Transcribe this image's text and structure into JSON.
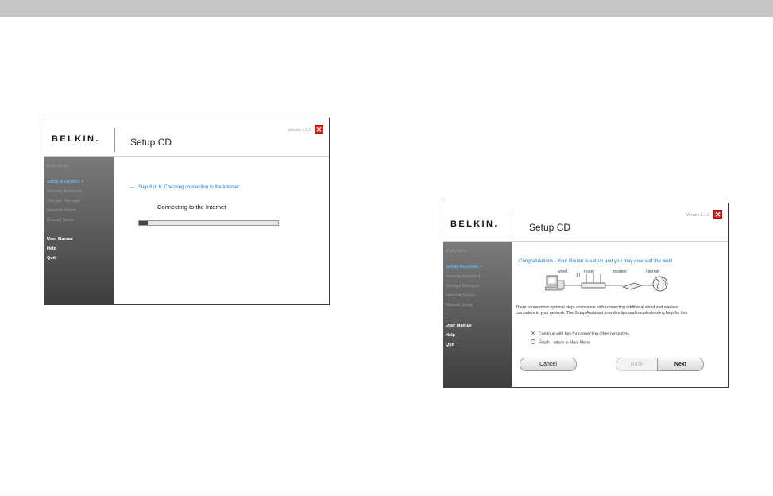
{
  "window1": {
    "logo": "BELKIN.",
    "title": "Setup CD",
    "version": "Version 1.1.2",
    "close": "✕",
    "sidebar": [
      {
        "label": "Main Menu"
      },
      {
        "label": "Setup Assistant  >"
      },
      {
        "label": "Security Assistant"
      },
      {
        "label": "Storage Manager"
      },
      {
        "label": "Network Status"
      },
      {
        "label": "Manual Setup"
      },
      {
        "label": "User Manual"
      },
      {
        "label": "Help"
      },
      {
        "label": "Quit"
      }
    ],
    "step": "Step 6 of 6: Checking connection to the Internet",
    "connecting": "Connecting to the Internet",
    "progress": 0.06
  },
  "window2": {
    "logo": "BELKIN.",
    "title": "Setup CD",
    "version": "Version 1.1.2",
    "close": "✕",
    "sidebar": [
      {
        "label": "Main Menu"
      },
      {
        "label": "Setup Assistant  >"
      },
      {
        "label": "Security Assistant"
      },
      {
        "label": "Storage Manager"
      },
      {
        "label": "Network Status"
      },
      {
        "label": "Manual Setup"
      },
      {
        "label": "User Manual"
      },
      {
        "label": "Help"
      },
      {
        "label": "Quit"
      }
    ],
    "congrats": "Congratulations - Your Router is set up and you may now surf the web!",
    "diagram": {
      "wired": "wired",
      "router": "router",
      "modem": "modem",
      "internet": "internet"
    },
    "description": "There is one more optional step- assistance with connecting additional wired and wireless computers to your network. The Setup Assistant provides tips and troubleshooting help for this.",
    "options": [
      {
        "label": "Continue with tips for connecting other computers.",
        "selected": true
      },
      {
        "label": "Finish - return to Main Menu",
        "selected": false
      }
    ],
    "buttons": {
      "cancel": "Cancel",
      "back": "Back",
      "next": "Next"
    }
  }
}
